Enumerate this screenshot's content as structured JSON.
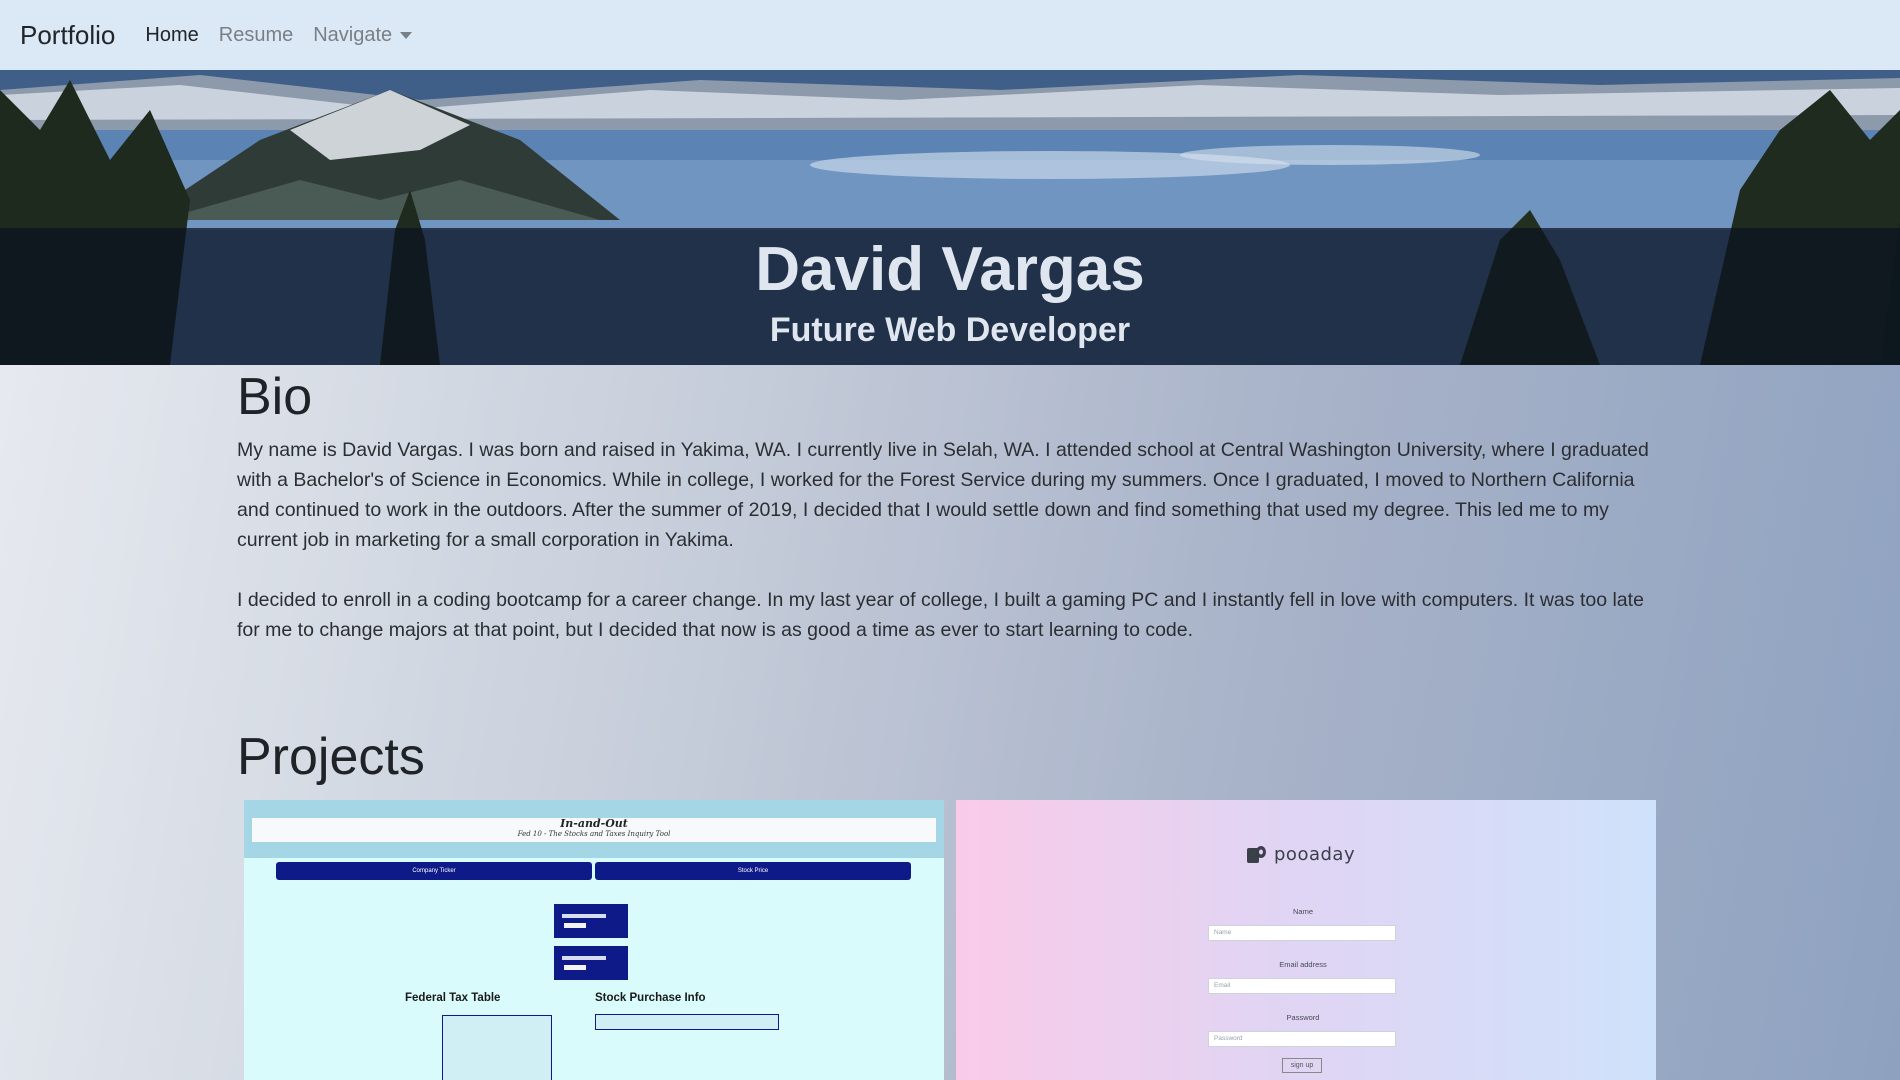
{
  "navbar": {
    "brand": "Portfolio",
    "links": [
      {
        "label": "Home",
        "active": true
      },
      {
        "label": "Resume",
        "active": false
      },
      {
        "label": "Navigate",
        "active": false,
        "dropdown": true
      }
    ]
  },
  "hero": {
    "name": "David Vargas",
    "subtitle": "Future Web Developer",
    "image": "mountain-lake-landscape"
  },
  "bio": {
    "title": "Bio",
    "paragraphs": [
      "My name is David Vargas. I was born and raised in Yakima, WA. I currently live in Selah, WA. I attended school at Central Washington University, where I graduated with a Bachelor's of Science in Economics. While in college, I worked for the Forest Service during my summers. Once I graduated, I moved to Northern California and continued to work in the outdoors. After the summer of 2019, I decided that I would settle down and find something that used my degree. This led me to my current job in marketing for a small corporation in Yakima.",
      "I decided to enroll in a coding bootcamp for a career change. In my last year of college, I built a gaming PC and I instantly fell in love with computers. It was too late for me to change majors at that point, but I decided that now is as good a time as ever to start learning to code."
    ]
  },
  "projects": {
    "title": "Projects",
    "cards": [
      {
        "title": "In-and-Out",
        "subtitle": "Fed 10 - The Stocks and Taxes Inquiry Tool",
        "button1": "Company Ticker",
        "button2": "Stock Price",
        "heading1": "Federal Tax Table",
        "heading2": "Stock Purchase Info"
      },
      {
        "logo": "pooaday",
        "name_label": "Name",
        "name_placeholder": "Name",
        "email_label": "Email address",
        "email_placeholder": "Email",
        "password_label": "Password",
        "password_placeholder": "Password",
        "button": "sign up"
      }
    ]
  }
}
